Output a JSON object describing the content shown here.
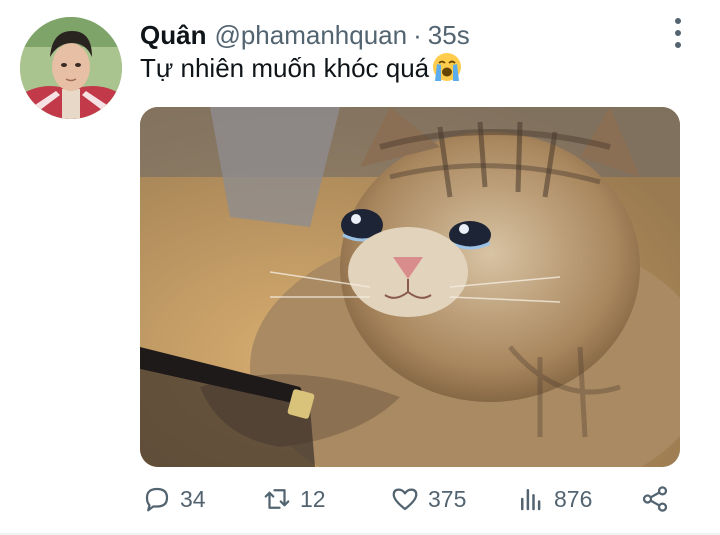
{
  "tweet": {
    "author_name": "Quân",
    "handle": "@phamanhquan",
    "separator": "·",
    "timestamp": "35s",
    "text": "Tự nhiên muốn khóc quá",
    "text_emoji": "loudly-crying-face-emoji"
  },
  "media": {
    "kind": "image",
    "subject": "crying-kitten-meme"
  },
  "actions": {
    "replies": "34",
    "retweets": "12",
    "likes": "375",
    "views": "876"
  },
  "icons": {
    "reply": "reply-icon",
    "retweet": "retweet-icon",
    "like": "heart-icon",
    "views": "views-icon",
    "share": "share-icon",
    "more": "more-options-icon"
  },
  "colors": {
    "text_primary": "#0f1419",
    "text_secondary": "#536471",
    "divider": "#eff3f4"
  }
}
